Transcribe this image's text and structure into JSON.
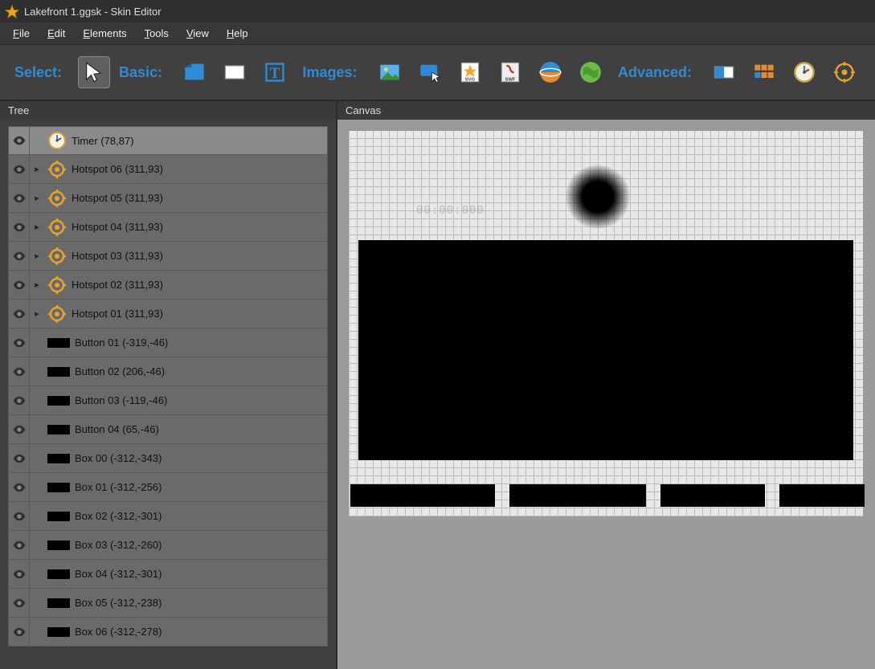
{
  "title": "Lakefront 1.ggsk - Skin Editor",
  "menu": [
    "File",
    "Edit",
    "Elements",
    "Tools",
    "View",
    "Help"
  ],
  "toolbar": {
    "groups": {
      "select": "Select:",
      "basic": "Basic:",
      "images": "Images:",
      "advanced": "Advanced:"
    }
  },
  "panels": {
    "tree_label": "Tree",
    "canvas_label": "Canvas"
  },
  "canvas": {
    "timer_text": "00:00:000"
  },
  "tree": [
    {
      "type": "timer",
      "label": "Timer  (78,87)",
      "expand": false,
      "selected": true
    },
    {
      "type": "hotspot",
      "label": "Hotspot 06 (311,93)",
      "expand": true
    },
    {
      "type": "hotspot",
      "label": "Hotspot 05 (311,93)",
      "expand": true
    },
    {
      "type": "hotspot",
      "label": "Hotspot 04 (311,93)",
      "expand": true
    },
    {
      "type": "hotspot",
      "label": "Hotspot 03 (311,93)",
      "expand": true
    },
    {
      "type": "hotspot",
      "label": "Hotspot 02 (311,93)",
      "expand": true
    },
    {
      "type": "hotspot",
      "label": "Hotspot 01 (311,93)",
      "expand": true
    },
    {
      "type": "button",
      "label": "Button 01 (-319,-46)"
    },
    {
      "type": "button",
      "label": "Button 02 (206,-46)"
    },
    {
      "type": "button",
      "label": "Button 03 (-119,-46)"
    },
    {
      "type": "button",
      "label": "Button 04 (65,-46)"
    },
    {
      "type": "box",
      "label": "Box 00 (-312,-343)"
    },
    {
      "type": "box",
      "label": "Box 01 (-312,-256)"
    },
    {
      "type": "box",
      "label": "Box 02 (-312,-301)"
    },
    {
      "type": "box",
      "label": "Box 03 (-312,-260)"
    },
    {
      "type": "box",
      "label": "Box 04 (-312,-301)"
    },
    {
      "type": "box",
      "label": "Box 05 (-312,-238)"
    },
    {
      "type": "box",
      "label": "Box 06 (-312,-278)"
    }
  ]
}
